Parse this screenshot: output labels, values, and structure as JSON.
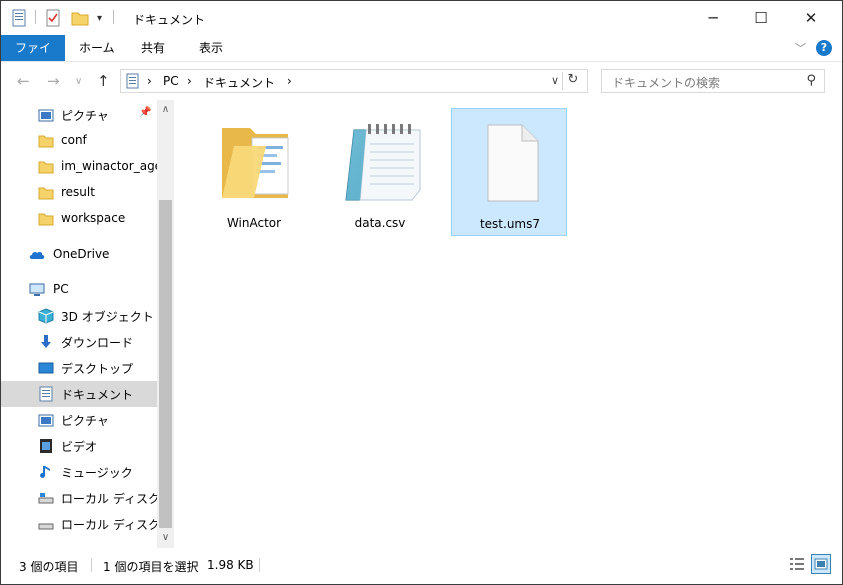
{
  "window": {
    "title": "ドキュメント",
    "controls": {
      "minimize": "─",
      "maximize": "☐",
      "close": "✕"
    }
  },
  "ribbon": {
    "tabs": [
      "ファイル",
      "ホーム",
      "共有",
      "表示"
    ],
    "help": "?"
  },
  "address": {
    "crumbs": [
      "PC",
      "ドキュメント"
    ],
    "separator": "›",
    "search_placeholder": "ドキュメントの検索"
  },
  "nav": {
    "items": [
      {
        "label": "ピクチャ",
        "icon": "pictures-icon",
        "pinned": true
      },
      {
        "label": "conf",
        "icon": "folder-icon"
      },
      {
        "label": "im_winactor_age",
        "icon": "folder-icon"
      },
      {
        "label": "result",
        "icon": "folder-icon"
      },
      {
        "label": "workspace",
        "icon": "folder-icon"
      },
      {
        "label": "OneDrive",
        "icon": "onedrive-icon"
      },
      {
        "label": "PC",
        "icon": "pc-icon"
      },
      {
        "label": "3D オブジェクト",
        "icon": "3d-objects-icon"
      },
      {
        "label": "ダウンロード",
        "icon": "download-icon"
      },
      {
        "label": "デスクトップ",
        "icon": "desktop-icon"
      },
      {
        "label": "ドキュメント",
        "icon": "documents-icon",
        "selected": true
      },
      {
        "label": "ピクチャ",
        "icon": "pictures-icon"
      },
      {
        "label": "ビデオ",
        "icon": "video-icon"
      },
      {
        "label": "ミュージック",
        "icon": "music-icon"
      },
      {
        "label": "ローカル ディスク (C",
        "icon": "drive-icon"
      },
      {
        "label": "ローカル ディスク (D",
        "icon": "drive-icon"
      }
    ]
  },
  "files": [
    {
      "name": "WinActor",
      "icon": "folder-icon"
    },
    {
      "name": "data.csv",
      "icon": "notepad-icon"
    },
    {
      "name": "test.ums7",
      "icon": "blank-file-icon",
      "selected": true
    }
  ],
  "status": {
    "item_count": "3 個の項目",
    "selection": "1 個の項目を選択",
    "size": "1.98 KB"
  },
  "colors": {
    "accent": "#1979ca",
    "selection": "#cce8ff",
    "selection_border": "#99d1ff"
  }
}
